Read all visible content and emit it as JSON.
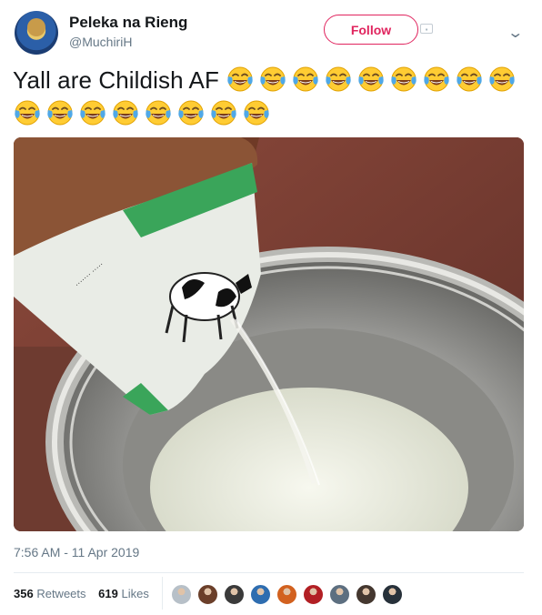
{
  "author": {
    "name": "Peleka na Rieng",
    "handle": "@MuchiriH",
    "avatar_icon": "profile-avatar"
  },
  "actions": {
    "follow_label": "Follow",
    "menu_icon": "chevron-down-icon"
  },
  "tweet": {
    "text": "Yall are Childish AF",
    "emoji_name": "face-with-tears-of-joy",
    "emoji_count": 17,
    "timestamp": "7:56 AM - 11 Apr 2019"
  },
  "stats": {
    "retweets_count": "356",
    "retweets_label": "Retweets",
    "likes_count": "619",
    "likes_label": "Likes"
  },
  "likers": [
    {
      "color": "#b7c0c8",
      "name": "default-avatar"
    },
    {
      "color": "#6b3f2a",
      "name": "liker-avatar"
    },
    {
      "color": "#3a3a3a",
      "name": "liker-avatar"
    },
    {
      "color": "#2e6db0",
      "name": "liker-avatar"
    },
    {
      "color": "#d2611f",
      "name": "liker-avatar"
    },
    {
      "color": "#b21f24",
      "name": "liker-avatar"
    },
    {
      "color": "#5d6f80",
      "name": "liker-avatar"
    },
    {
      "color": "#44372f",
      "name": "liker-avatar"
    },
    {
      "color": "#27313a",
      "name": "liker-avatar"
    }
  ],
  "colors": {
    "follow_accent": "#e0245e",
    "secondary_text": "#657786",
    "primary_text": "#14171a"
  }
}
